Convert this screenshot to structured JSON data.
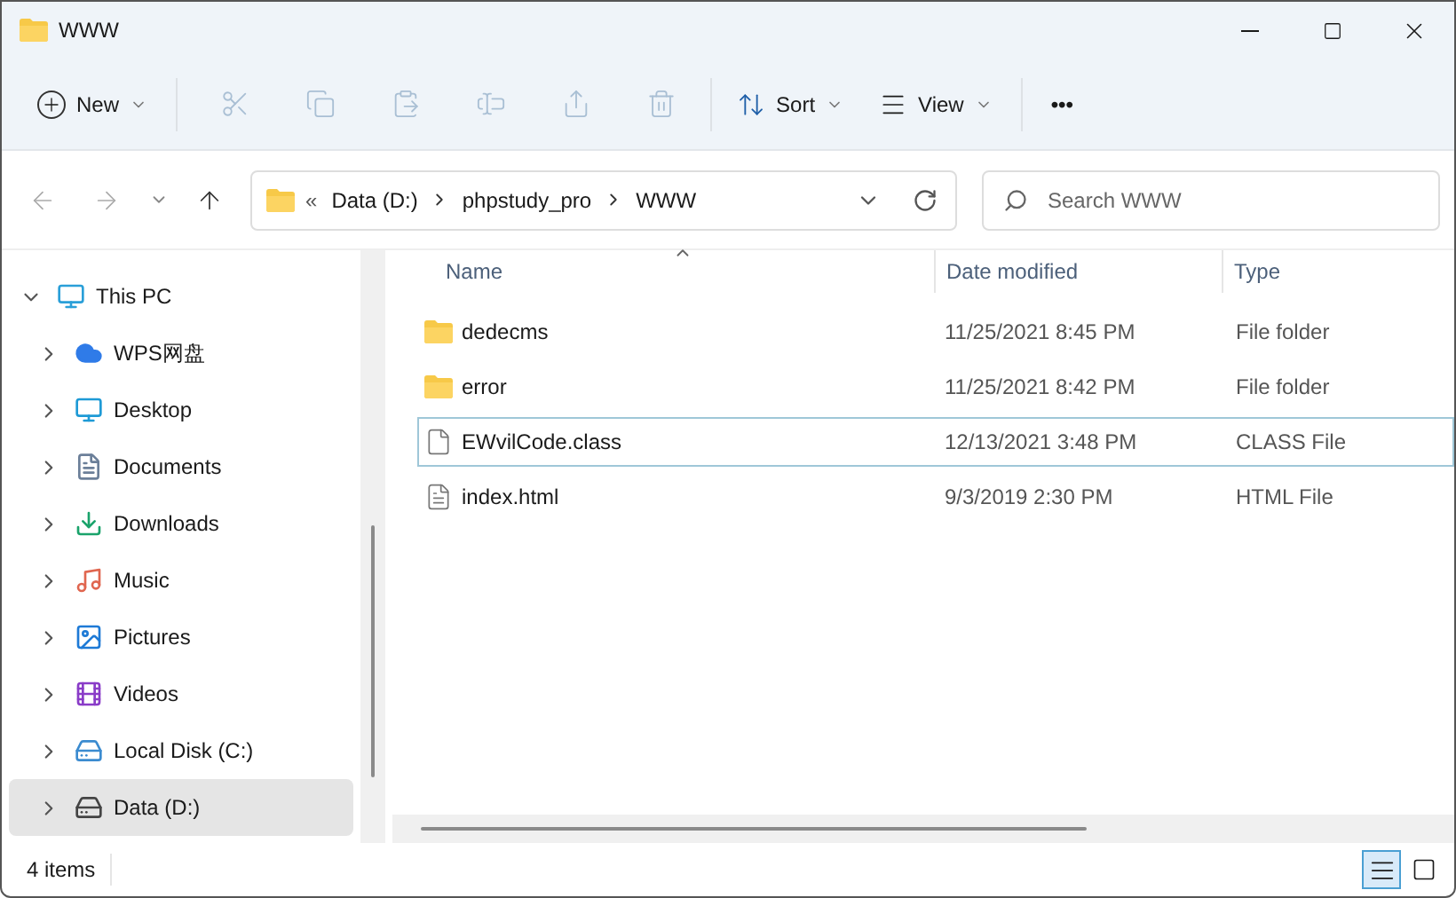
{
  "window": {
    "title": "WWW"
  },
  "toolbar": {
    "new": "New",
    "sort": "Sort",
    "view": "View",
    "more": "•••"
  },
  "address": {
    "overflow": "«",
    "crumbs": [
      "Data (D:)",
      "phpstudy_pro",
      "WWW"
    ]
  },
  "search": {
    "placeholder": "Search WWW"
  },
  "sidebar": {
    "items": [
      {
        "label": "This PC",
        "kind": "pc",
        "expanded": true,
        "selected": false,
        "children": [
          {
            "label": "WPS网盘",
            "kind": "cloud",
            "expanded": false,
            "selected": false
          },
          {
            "label": "Desktop",
            "kind": "desktop",
            "expanded": false,
            "selected": false
          },
          {
            "label": "Documents",
            "kind": "documents",
            "expanded": false,
            "selected": false
          },
          {
            "label": "Downloads",
            "kind": "downloads",
            "expanded": false,
            "selected": false
          },
          {
            "label": "Music",
            "kind": "music",
            "expanded": false,
            "selected": false
          },
          {
            "label": "Pictures",
            "kind": "pictures",
            "expanded": false,
            "selected": false
          },
          {
            "label": "Videos",
            "kind": "videos",
            "expanded": false,
            "selected": false
          },
          {
            "label": "Local Disk (C:)",
            "kind": "system-drive",
            "expanded": false,
            "selected": false
          },
          {
            "label": "Data (D:)",
            "kind": "drive",
            "expanded": false,
            "selected": true
          }
        ]
      }
    ]
  },
  "table": {
    "columns": [
      "Name",
      "Date modified",
      "Type"
    ],
    "rows": [
      {
        "name": "dedecms",
        "kind": "folder",
        "date": "11/25/2021 8:45 PM",
        "type": "File folder",
        "focused": false
      },
      {
        "name": "error",
        "kind": "folder",
        "date": "11/25/2021 8:42 PM",
        "type": "File folder",
        "focused": false
      },
      {
        "name": "EWvilCode.class",
        "kind": "file",
        "date": "12/13/2021 3:48 PM",
        "type": "CLASS File",
        "focused": true
      },
      {
        "name": "index.html",
        "kind": "text-file",
        "date": "9/3/2019 2:30 PM",
        "type": "HTML File",
        "focused": false
      }
    ]
  },
  "status_bar": {
    "count": "4 items",
    "view_buttons": [
      {
        "kind": "details",
        "selected": true
      },
      {
        "kind": "preview",
        "selected": false
      }
    ]
  }
}
